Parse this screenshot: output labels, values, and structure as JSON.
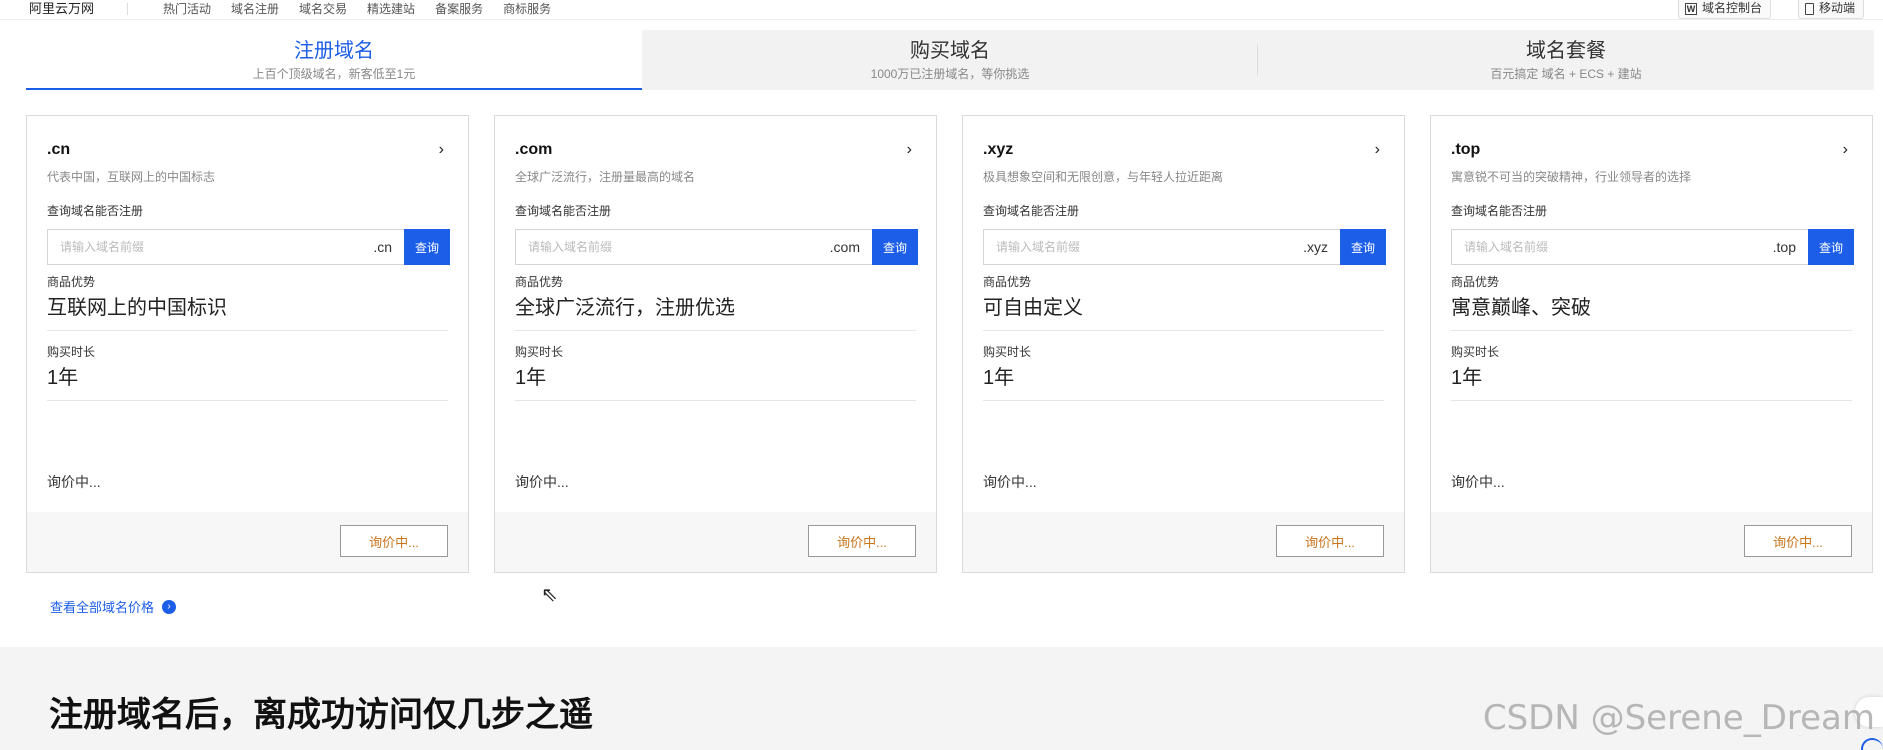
{
  "topbar": {
    "brand": "阿里云万网",
    "nav": [
      "热门活动",
      "域名注册",
      "域名交易",
      "精选建站",
      "备案服务",
      "商标服务"
    ],
    "console_label": "域名控制台",
    "mobile_label": "移动端"
  },
  "tabs": [
    {
      "title": "注册域名",
      "subtitle": "上百个顶级域名，新客低至1元",
      "active": true
    },
    {
      "title": "购买域名",
      "subtitle": "1000万已注册域名，等你挑选",
      "active": false
    },
    {
      "title": "域名套餐",
      "subtitle": "百元搞定 域名 + ECS + 建站",
      "active": false
    }
  ],
  "cards": [
    {
      "tld": ".cn",
      "desc": "代表中国，互联网上的中国标志",
      "search_label": "查询域名能否注册",
      "placeholder": "请输入域名前缀",
      "suffix": ".cn",
      "search_btn": "查询",
      "advantage_label": "商品优势",
      "advantage": "互联网上的中国标识",
      "duration_label": "购买时长",
      "duration": "1年",
      "price": "询价中...",
      "cta": "询价中..."
    },
    {
      "tld": ".com",
      "desc": "全球广泛流行，注册量最高的域名",
      "search_label": "查询域名能否注册",
      "placeholder": "请输入域名前缀",
      "suffix": ".com",
      "search_btn": "查询",
      "advantage_label": "商品优势",
      "advantage": "全球广泛流行，注册优选",
      "duration_label": "购买时长",
      "duration": "1年",
      "price": "询价中...",
      "cta": "询价中..."
    },
    {
      "tld": ".xyz",
      "desc": "极具想象空间和无限创意，与年轻人拉近距离",
      "search_label": "查询域名能否注册",
      "placeholder": "请输入域名前缀",
      "suffix": ".xyz",
      "search_btn": "查询",
      "advantage_label": "商品优势",
      "advantage": "可自由定义",
      "duration_label": "购买时长",
      "duration": "1年",
      "price": "询价中...",
      "cta": "询价中..."
    },
    {
      "tld": ".top",
      "desc": "寓意锐不可当的突破精神，行业领导者的选择",
      "search_label": "查询域名能否注册",
      "placeholder": "请输入域名前缀",
      "suffix": ".top",
      "search_btn": "查询",
      "advantage_label": "商品优势",
      "advantage": "寓意巅峰、突破",
      "duration_label": "购买时长",
      "duration": "1年",
      "price": "询价中...",
      "cta": "询价中..."
    }
  ],
  "all_prices_link": "查看全部域名价格",
  "section_title": "注册域名后，离成功访问仅几步之遥",
  "watermark": "CSDN @Serene_Dream",
  "colors": {
    "accent": "#1c5ee8",
    "cta_text": "#c9741a"
  }
}
